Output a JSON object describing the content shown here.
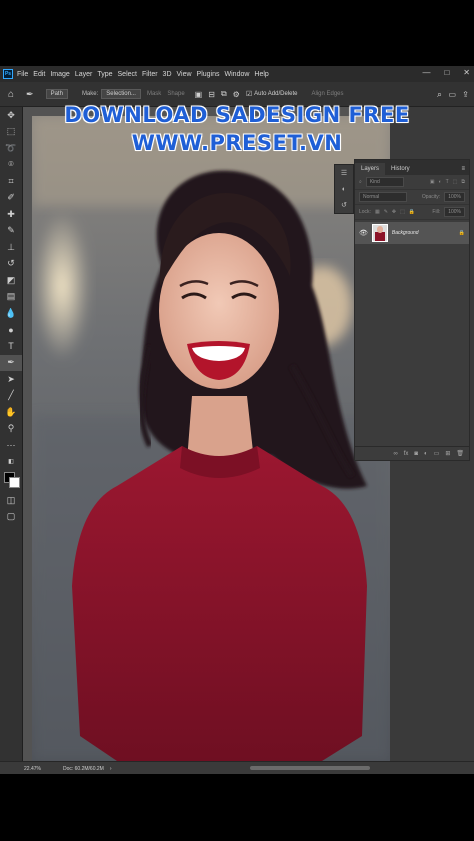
{
  "menu": {
    "app_icon_label": "Ps",
    "items": [
      "File",
      "Edit",
      "Image",
      "Layer",
      "Type",
      "Select",
      "Filter",
      "3D",
      "View",
      "Plugins",
      "Window",
      "Help"
    ],
    "window_controls": [
      "—",
      "□",
      "✕"
    ]
  },
  "options_bar": {
    "mode_value": "Path",
    "make_label": "Make:",
    "selection_label": "Selection...",
    "mask_label": "Mask",
    "shape_label": "Shape",
    "auto_add_delete_label": "Auto Add/Delete",
    "align_edges_label": "Align Edges"
  },
  "watermark": {
    "line1": "DOWNLOAD SADESIGN FREE",
    "line2": "WWW.PRESET.VN"
  },
  "layers_panel": {
    "tabs": [
      "Layers",
      "History"
    ],
    "kind_placeholder": "Kind",
    "blend_mode": "Normal",
    "opacity_label": "Opacity:",
    "opacity_value": "100%",
    "lock_label": "Lock:",
    "fill_label": "Fill:",
    "fill_value": "100%",
    "layers": [
      {
        "name": "Background"
      }
    ]
  },
  "status": {
    "zoom": "22.47%",
    "doc_info": "Doc: 60.2M/60.2M"
  },
  "colors": {
    "dress": "#8c1328",
    "hair": "#24181a",
    "skin": "#eab9a4",
    "watermark": "#1f5fd6"
  }
}
